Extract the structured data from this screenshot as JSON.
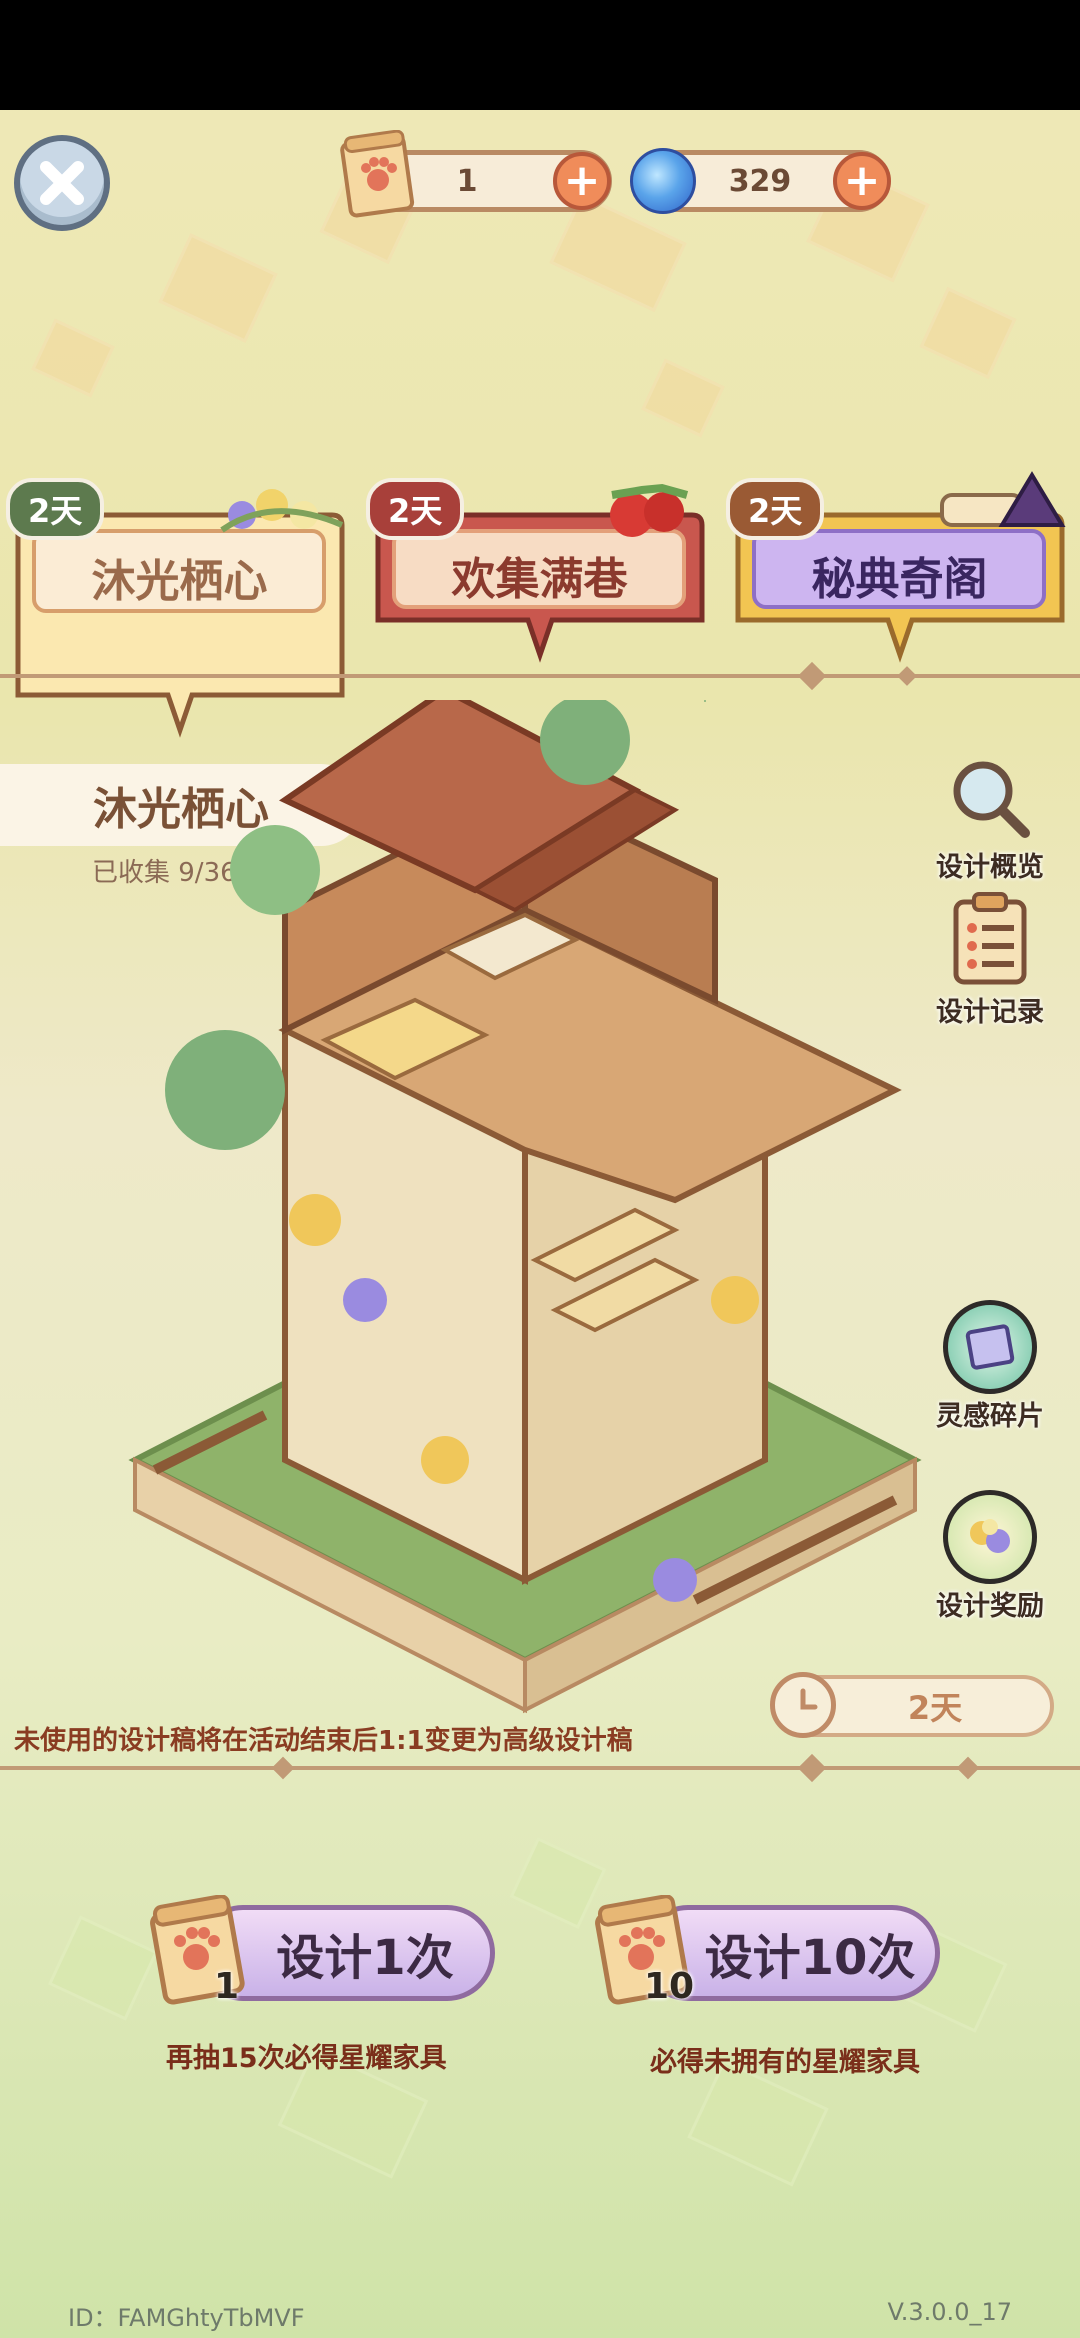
{
  "resources": {
    "design_tickets": "1",
    "orbs": "329"
  },
  "tabs": [
    {
      "badge": "2天",
      "label": "沐光栖心"
    },
    {
      "badge": "2天",
      "label": "欢集满巷"
    },
    {
      "badge": "2天",
      "label": "秘典奇阁"
    }
  ],
  "collection": {
    "title": "沐光栖心",
    "collected": "已收集 9/36"
  },
  "side_menu": {
    "overview": "设计概览",
    "records": "设计记录",
    "fragments": "灵感碎片",
    "rewards": "设计奖励"
  },
  "notice": "未使用的设计稿将在活动结束后1:1变更为高级设计稿",
  "timer": "2天",
  "draw_once": {
    "label": "设计1次",
    "cost": "1",
    "hint": "再抽15次必得星耀家具"
  },
  "draw_ten": {
    "label": "设计10次",
    "cost": "10",
    "hint": "必得未拥有的星耀家具"
  },
  "footer": {
    "id": "ID：FAMGhtyTbMVF",
    "version": "V.3.0.0_17"
  },
  "colors": {
    "accent_red": "#c9574e",
    "tab_gold": "#f2c552",
    "badge_green": "#5d7a4e",
    "badge_red": "#a8403a",
    "badge_brown": "#9a5a34"
  }
}
